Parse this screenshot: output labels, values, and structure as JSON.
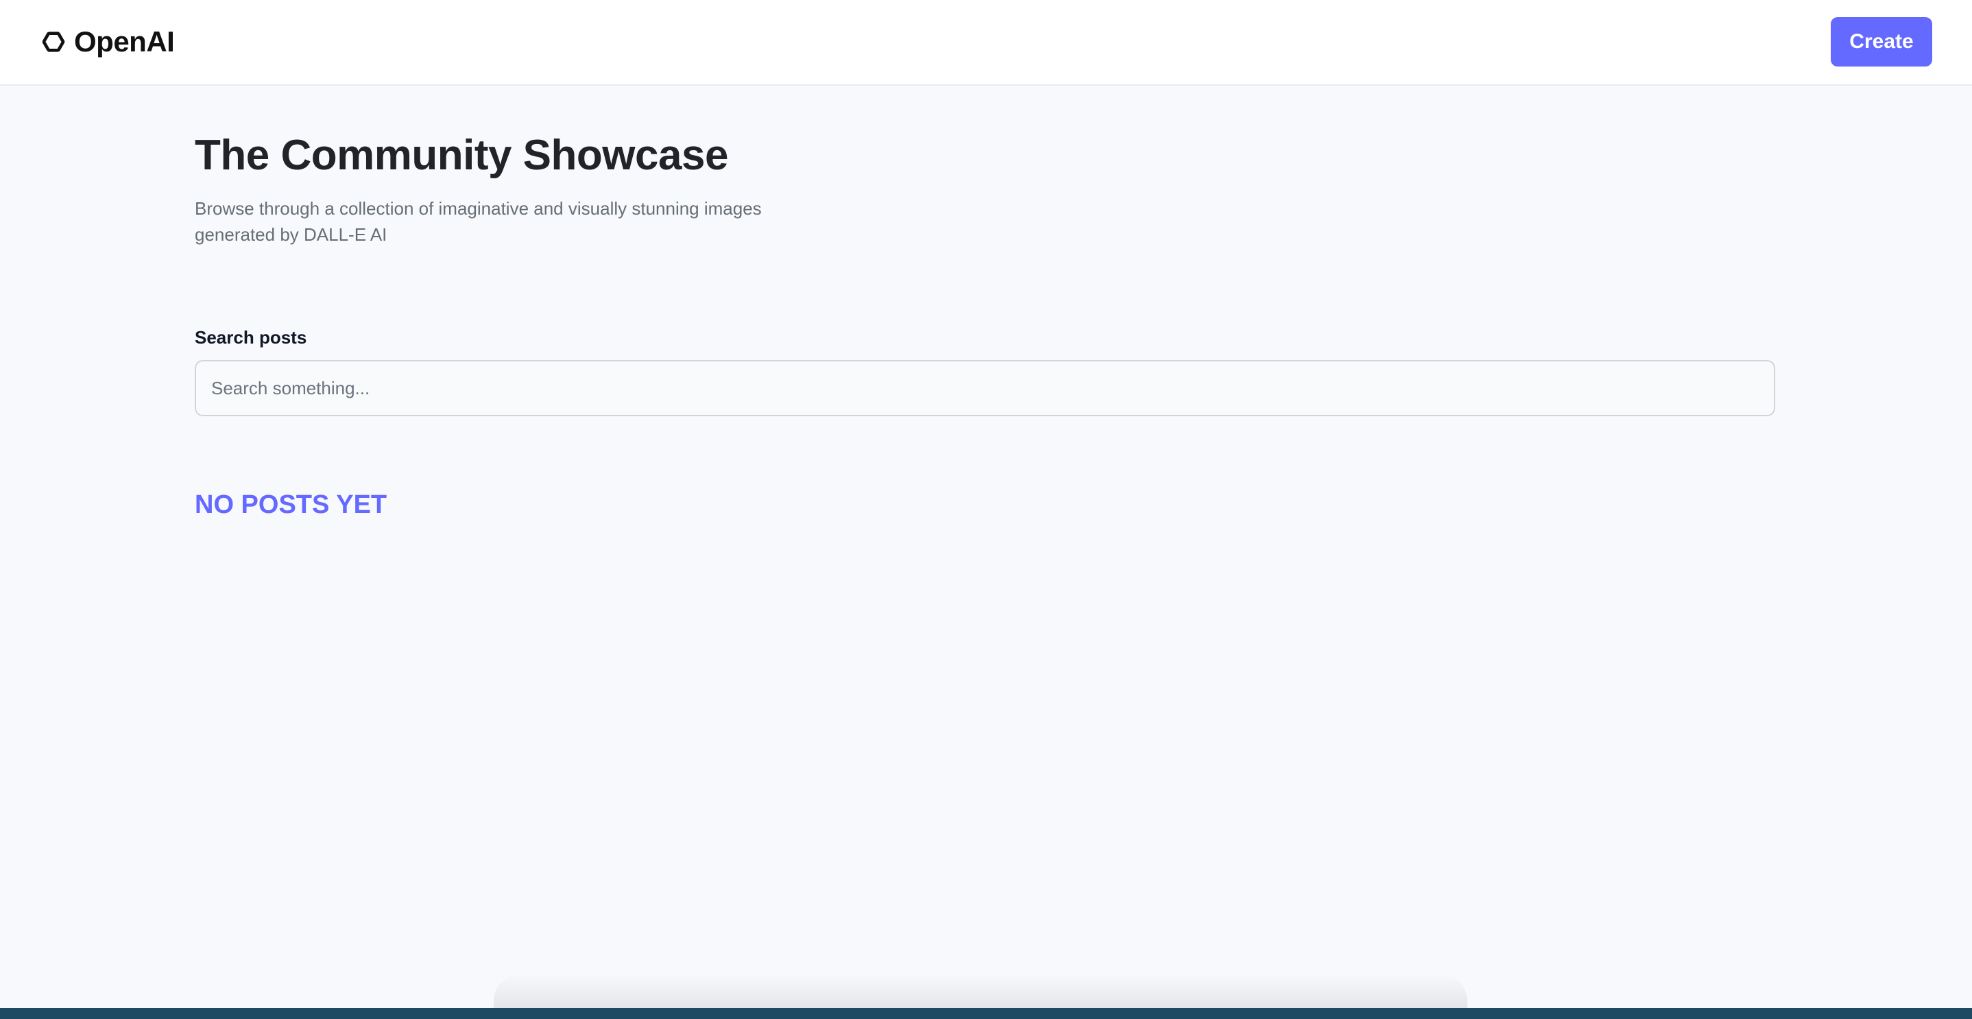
{
  "header": {
    "brand": "OpenAI",
    "brand_icon": "openai-logo-icon",
    "create_label": "Create",
    "accent_color": "#6469ff"
  },
  "main": {
    "title": "The Community Showcase",
    "subtitle": "Browse through a collection of imaginative and visually stunning images generated by DALL-E AI",
    "search": {
      "label": "Search posts",
      "placeholder": "Search something...",
      "value": ""
    },
    "empty_message": "NO POSTS YET"
  }
}
